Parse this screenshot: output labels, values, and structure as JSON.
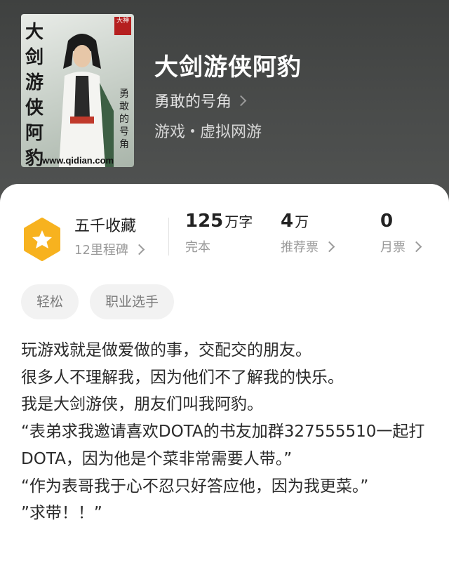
{
  "book": {
    "title": "大剑游侠阿豹",
    "author": "勇敢的号角",
    "genre_main": "游戏",
    "genre_sub": "虚拟网游"
  },
  "cover": {
    "title_text": "大剑游侠阿豹",
    "author_text": "勇敢的号角",
    "site_text": "www.qidian.com",
    "badge_text": "大神"
  },
  "stats": {
    "collection_label": "五千收藏",
    "milestone_label": "12里程碑",
    "words_value": "125",
    "words_unit": "万字",
    "words_status": "完本",
    "recommend_value": "4",
    "recommend_unit": "万",
    "recommend_label": "推荐票",
    "monthly_value": "0",
    "monthly_label": "月票"
  },
  "tags": [
    "轻松",
    "职业选手"
  ],
  "description": [
    "玩游戏就是做爱做的事，交配交的朋友。",
    "很多人不理解我，因为他们不了解我的快乐。",
    "我是大剑游侠，朋友们叫我阿豹。",
    "“表弟求我邀请喜欢DOTA的书友加群327555510一起打DOTA，因为他是个菜非常需要人带。”",
    "“作为表哥我于心不忍只好答应他，因为我更菜。”",
    "”求带！！”"
  ],
  "colors": {
    "header_bg": "#474948",
    "medal": "#f7b21f",
    "tag_bg": "#f2f2f2"
  }
}
